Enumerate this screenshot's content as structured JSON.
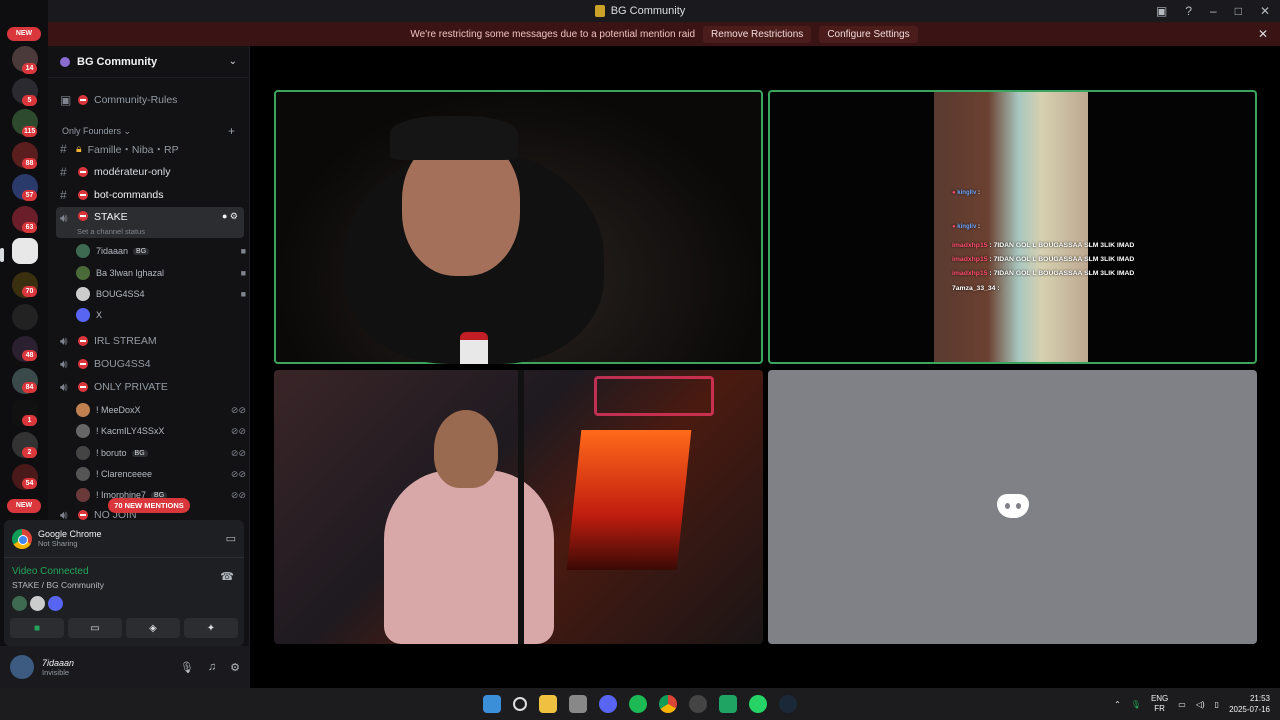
{
  "window": {
    "title": "BG Community"
  },
  "banner": {
    "text": "We're restricting some messages due to a potential mention raid",
    "remove": "Remove Restrictions",
    "configure": "Configure Settings"
  },
  "rail": {
    "new_top": "NEW",
    "new_bottom": "NEW",
    "badges": [
      "14",
      "5",
      "115",
      "88",
      "57",
      "63",
      "70",
      "48",
      "84",
      "1",
      "2",
      "54"
    ]
  },
  "guild": {
    "name": "BG Community"
  },
  "channels": {
    "rules": "Community-Rules",
    "category": "Only Founders",
    "famille": "Famille・Niba・RP",
    "moderateur": "modérateur-only",
    "bot": "bot-commands",
    "stake": "STAKE",
    "stake_status": "Set a channel status",
    "irl": "IRL STREAM",
    "boug": "BOUG4SS4",
    "only_private": "ONLY PRIVATE",
    "no_join": "NO JOIN"
  },
  "voice_users": [
    {
      "name": "7idaaan",
      "tag": "BG"
    },
    {
      "name": "Ba 3lwan lghazal",
      "tag": ""
    },
    {
      "name": "BOUG4SS4",
      "tag": ""
    },
    {
      "name": "X",
      "tag": ""
    }
  ],
  "private_users": [
    {
      "name": "! MeeDoxX",
      "tag": ""
    },
    {
      "name": "! KacmILY4SSxX",
      "tag": ""
    },
    {
      "name": "! boruto",
      "tag": "BG"
    },
    {
      "name": "! Clarenceeee",
      "tag": ""
    },
    {
      "name": "! Imorphine7",
      "tag": "BG"
    }
  ],
  "mentions": "70 NEW MENTIONS",
  "share": {
    "app": "Google Chrome",
    "status": "Not Sharing"
  },
  "voice": {
    "status": "Video Connected",
    "location": "STAKE / BG Community"
  },
  "me": {
    "name": "7idaaan",
    "status": "Invisible"
  },
  "stream_chat": [
    {
      "user": "imadxhp15",
      "msg": "7IDAN GOL L BOUGASSAA SLM 3LIK IMAD"
    },
    {
      "user": "imadxhp15",
      "msg": "7IDAN GOL L BOUGASSAA SLM 3LIK IMAD"
    },
    {
      "user": "imadxhp15",
      "msg": "7IDAN GOL L BOUGASSAA SLM 3LIK IMAD"
    },
    {
      "user": "7amza_33_34",
      "msg": ""
    }
  ],
  "stream_chat_top": [
    "kingliv",
    "kingliv"
  ],
  "tray": {
    "lang1": "ENG",
    "lang2": "FR",
    "time": "21:53",
    "date": "2025-07-16"
  },
  "colors": {
    "accent": "#3ba55d",
    "danger": "#da373c"
  }
}
